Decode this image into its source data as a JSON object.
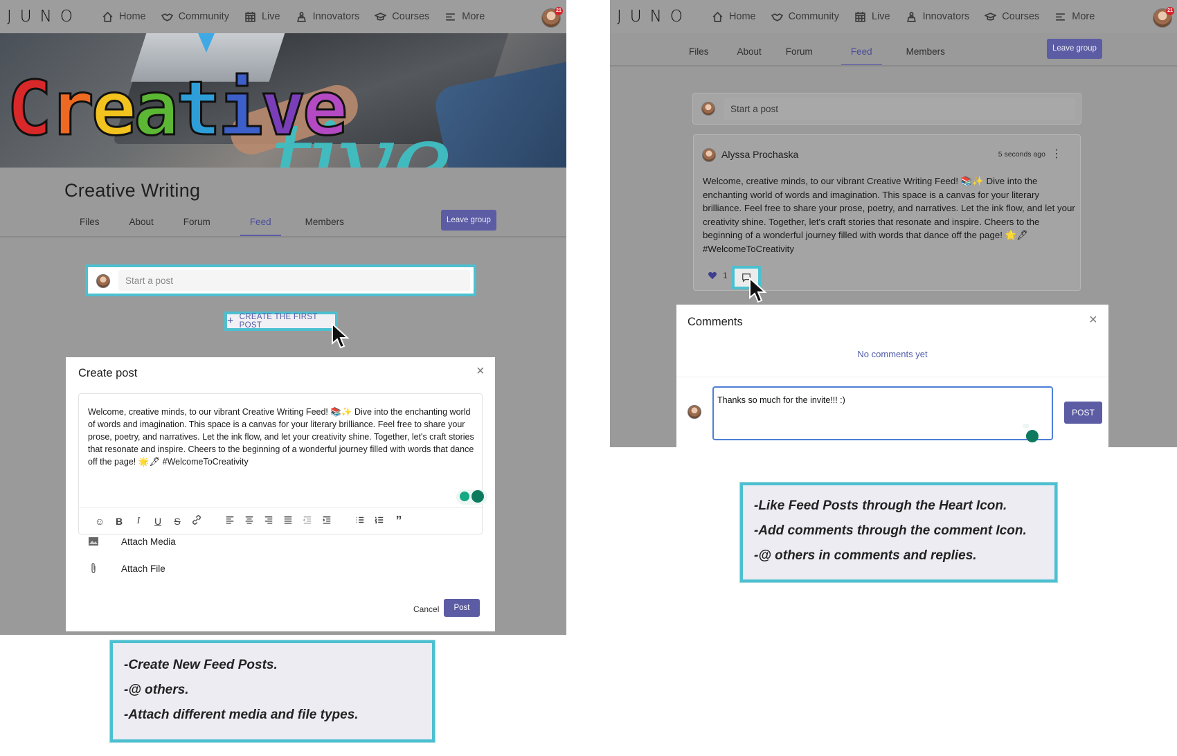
{
  "brand": {
    "logo_text": "JUNO"
  },
  "nav": {
    "items": [
      {
        "label": "Home",
        "icon": "home-icon"
      },
      {
        "label": "Community",
        "icon": "handshake-icon"
      },
      {
        "label": "Live",
        "icon": "calendar-icon"
      },
      {
        "label": "Innovators",
        "icon": "person-podium-icon"
      },
      {
        "label": "Courses",
        "icon": "graduation-cap-icon"
      },
      {
        "label": "More",
        "icon": "menu-lines-icon"
      }
    ],
    "notification_count": "21"
  },
  "banner": {
    "word": [
      "C",
      "r",
      "e",
      "a",
      "t",
      "i",
      "v",
      "e"
    ],
    "script": "tive"
  },
  "group": {
    "title": "Creative Writing",
    "tabs": [
      "Files",
      "About",
      "Forum",
      "Feed",
      "Members"
    ],
    "active_tab": "Feed",
    "leave_label": "Leave group"
  },
  "composer": {
    "placeholder": "Start a post",
    "first_post_label": "CREATE THE FIRST POST"
  },
  "create_post": {
    "title": "Create post",
    "text": "Welcome, creative minds, to our vibrant Creative Writing Feed! 📚✨ Dive into the enchanting world of words and imagination. This space is a canvas for your literary brilliance. Feel free to share your prose, poetry, and narratives. Let the ink flow, and let your creativity shine. Together, let's craft stories that resonate and inspire. Cheers to the beginning of a wonderful journey filled with words that dance off the page! 🌟🖋 #WelcomeToCreativity",
    "attach_media": "Attach Media",
    "attach_file": "Attach File",
    "cancel": "Cancel",
    "post": "Post"
  },
  "callout_left": [
    "-Create New Feed Posts.",
    "-@ others.",
    "-Attach different media and file types."
  ],
  "feed_post": {
    "author": "Alyssa Prochaska",
    "time": "5 seconds ago",
    "body": "Welcome, creative minds, to our vibrant Creative Writing Feed! 📚✨ Dive into the enchanting world of words and imagination. This space is a canvas for your literary brilliance. Feel free to share your prose, poetry, and narratives. Let the ink flow, and let your creativity shine. Together, let's craft stories that resonate and inspire. Cheers to the beginning of a wonderful journey filled with words that dance off the page! 🌟🖋 #WelcomeToCreativity",
    "like_count": "1"
  },
  "comments": {
    "title": "Comments",
    "empty": "No comments yet",
    "input_value": "Thanks so much for the invite!!! :)",
    "post": "POST"
  },
  "callout_right": [
    "-Like Feed Posts through the Heart Icon.",
    "-Add comments through the comment Icon.",
    "-@ others in comments and replies."
  ],
  "colors": {
    "accent": "#5c5ca4",
    "highlight": "#4cc0d0",
    "overlay": "#9a9a9a"
  }
}
